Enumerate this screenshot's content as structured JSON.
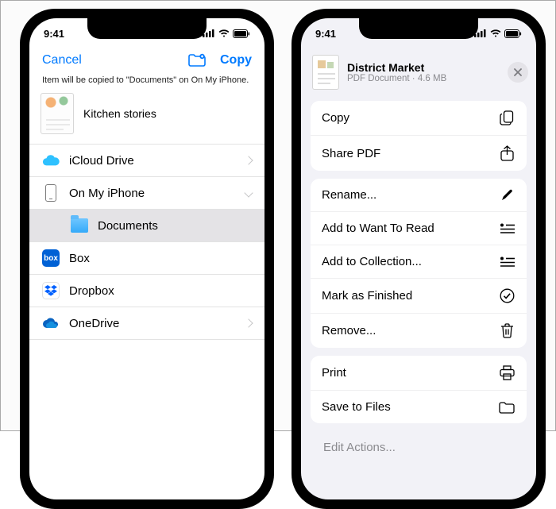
{
  "status": {
    "time": "9:41"
  },
  "left": {
    "header": {
      "cancel_label": "Cancel",
      "copy_label": "Copy"
    },
    "hint": "Item will be copied to \"Documents\" on On My iPhone.",
    "file": {
      "name": "Kitchen stories"
    },
    "locations": [
      {
        "id": "icloud",
        "label": "iCloud Drive",
        "expandable": true,
        "expanded": false,
        "selected": false
      },
      {
        "id": "onmyiphone",
        "label": "On My iPhone",
        "expandable": true,
        "expanded": true,
        "selected": false
      },
      {
        "id": "documents",
        "label": "Documents",
        "expandable": false,
        "expanded": false,
        "selected": true,
        "indent": true
      },
      {
        "id": "box",
        "label": "Box",
        "expandable": false,
        "expanded": false,
        "selected": false
      },
      {
        "id": "dropbox",
        "label": "Dropbox",
        "expandable": false,
        "expanded": false,
        "selected": false
      },
      {
        "id": "onedrive",
        "label": "OneDrive",
        "expandable": true,
        "expanded": false,
        "selected": false
      }
    ]
  },
  "right": {
    "doc": {
      "title": "District Market",
      "type": "PDF Document",
      "size": "4.6 MB"
    },
    "groups": [
      {
        "items": [
          {
            "id": "copy",
            "label": "Copy",
            "icon": "copy"
          },
          {
            "id": "share",
            "label": "Share PDF",
            "icon": "share"
          }
        ]
      },
      {
        "items": [
          {
            "id": "rename",
            "label": "Rename...",
            "icon": "pencil"
          },
          {
            "id": "want",
            "label": "Add to Want To Read",
            "icon": "list"
          },
          {
            "id": "collection",
            "label": "Add to Collection...",
            "icon": "list"
          },
          {
            "id": "finished",
            "label": "Mark as Finished",
            "icon": "check"
          },
          {
            "id": "remove",
            "label": "Remove...",
            "icon": "trash"
          }
        ]
      },
      {
        "items": [
          {
            "id": "print",
            "label": "Print",
            "icon": "print"
          },
          {
            "id": "save",
            "label": "Save to Files",
            "icon": "folder"
          }
        ]
      }
    ],
    "edit_actions_label": "Edit Actions..."
  }
}
